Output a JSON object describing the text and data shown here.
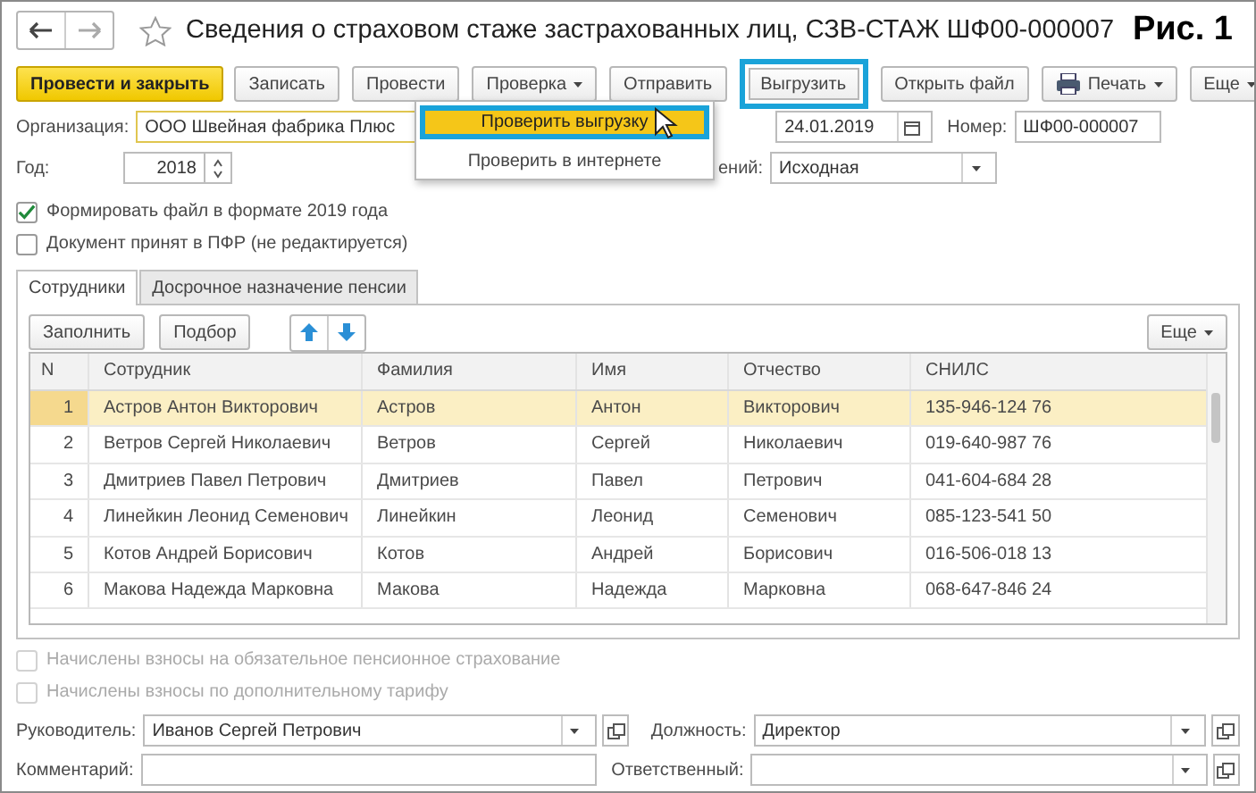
{
  "window": {
    "title": "Сведения о страховом стаже застрахованных лиц, СЗВ-СТАЖ ШФ00-000007",
    "figure_label": "Рис. 1"
  },
  "toolbar": [
    {
      "label": "Провести и закрыть",
      "kind": "primary",
      "annotated": false
    },
    {
      "label": "Записать",
      "kind": "plain",
      "annotated": false
    },
    {
      "label": "Провести",
      "kind": "plain",
      "annotated": false
    },
    {
      "label": "Проверка",
      "kind": "menu",
      "annotated": false
    },
    {
      "label": "Отправить",
      "kind": "plain",
      "annotated": false
    },
    {
      "label": "Выгрузить",
      "kind": "plain",
      "annotated": true
    },
    {
      "label": "Открыть файл",
      "kind": "plain",
      "annotated": false
    },
    {
      "label": "Печать",
      "kind": "print",
      "annotated": false
    },
    {
      "label": "Еще",
      "kind": "menu",
      "annotated": false
    }
  ],
  "menu": {
    "items": [
      {
        "label": "Проверить выгрузку",
        "selected": true,
        "annotated": true
      },
      {
        "label": "Проверить в интернете",
        "selected": false,
        "annotated": false
      }
    ]
  },
  "organization": {
    "label": "Организация:",
    "value": "ООО Швейная фабрика Плюс",
    "focused": true
  },
  "date": {
    "value": "24.01.2019"
  },
  "number": {
    "label": "Номер:",
    "value": "ШФ00-000007"
  },
  "year": {
    "label": "Год:",
    "value": "2018"
  },
  "info_type": {
    "label": "ений:",
    "value": "Исходная"
  },
  "checkboxes": [
    {
      "label": "Формировать файл в формате 2019 года",
      "checked": true,
      "disabled": false
    },
    {
      "label": "Документ принят в ПФР (не редактируется)",
      "checked": false,
      "disabled": false
    }
  ],
  "tabs": [
    {
      "label": "Сотрудники",
      "selected": true
    },
    {
      "label": "Досрочное назначение пенсии",
      "selected": false
    }
  ],
  "table_toolbar": {
    "buttons": [
      "Заполнить",
      "Подбор"
    ],
    "more": "Еще"
  },
  "table": {
    "columns": [
      "N",
      "Сотрудник",
      "Фамилия",
      "Имя",
      "Отчество",
      "СНИЛС"
    ],
    "rows": [
      {
        "cells": [
          "1",
          "Астров Антон Викторович",
          "Астров",
          "Антон",
          "Викторович",
          "135-946-124 76"
        ],
        "selected": true
      },
      {
        "cells": [
          "2",
          "Ветров Сергей Николаевич",
          "Ветров",
          "Сергей",
          "Николаевич",
          "019-640-987 76"
        ],
        "selected": false
      },
      {
        "cells": [
          "3",
          "Дмитриев Павел Петрович",
          "Дмитриев",
          "Павел",
          "Петрович",
          "041-604-684 28"
        ],
        "selected": false
      },
      {
        "cells": [
          "4",
          "Линейкин Леонид Семенович",
          "Линейкин",
          "Леонид",
          "Семенович",
          "085-123-541 50"
        ],
        "selected": false
      },
      {
        "cells": [
          "5",
          "Котов Андрей Борисович",
          "Котов",
          "Андрей",
          "Борисович",
          "016-506-018 13"
        ],
        "selected": false
      },
      {
        "cells": [
          "6",
          "Макова Надежда Марковна",
          "Макова",
          "Надежда",
          "Марковна",
          "068-647-846 24"
        ],
        "selected": false
      }
    ]
  },
  "contributions": [
    {
      "label": "Начислены взносы на обязательное пенсионное страхование",
      "checked": false,
      "disabled": true
    },
    {
      "label": "Начислены взносы по дополнительному тарифу",
      "checked": false,
      "disabled": true
    }
  ],
  "footer": [
    {
      "label": "Руководитель:",
      "value": "Иванов Сергей Петрович",
      "kind": "select"
    },
    {
      "label": "Должность:",
      "value": "Директор",
      "kind": "select"
    },
    {
      "label": "Комментарий:",
      "kind": "text"
    },
    {
      "label": "Ответственный:",
      "kind": "select"
    }
  ]
}
